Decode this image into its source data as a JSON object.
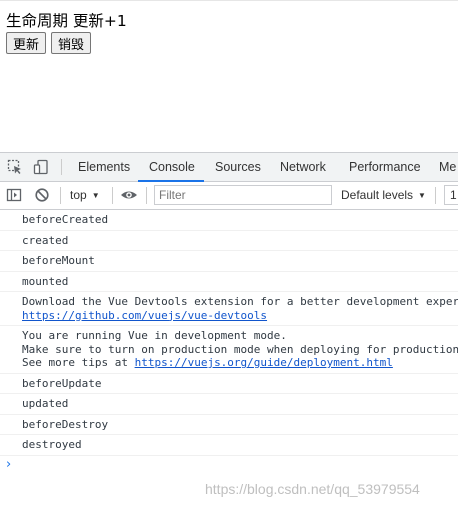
{
  "page": {
    "title": "生命周期 更新+1",
    "update_button": "更新",
    "destroy_button": "销毁"
  },
  "devtools": {
    "tabs": [
      {
        "label": "Elements"
      },
      {
        "label": "Console"
      },
      {
        "label": "Sources"
      },
      {
        "label": "Network"
      },
      {
        "label": "Performance"
      },
      {
        "label": "Me"
      }
    ],
    "active_tab": "Console",
    "toolbar": {
      "context": "top",
      "filter_placeholder": "Filter",
      "levels": "Default levels",
      "count": "1"
    },
    "console": {
      "messages": [
        {
          "text": "beforeCreated"
        },
        {
          "text": "created"
        },
        {
          "text": "beforeMount"
        },
        {
          "text": "mounted"
        },
        {
          "line1": "Download the Vue Devtools extension for a better development exper",
          "link": "https://github.com/vuejs/vue-devtools"
        },
        {
          "line1": "You are running Vue in development mode.",
          "line2": "Make sure to turn on production mode when deploying for production",
          "line3_prefix": "See more tips at ",
          "link": "https://vuejs.org/guide/deployment.html"
        },
        {
          "text": "beforeUpdate"
        },
        {
          "text": "updated"
        },
        {
          "text": "beforeDestroy"
        },
        {
          "text": "destroyed"
        }
      ],
      "prompt": "›"
    }
  },
  "watermark": "https://blog.csdn.net/qq_53979554",
  "colors": {
    "accent": "#1a73e8",
    "link": "#1155cc",
    "tabbar_bg": "#f1f3f4"
  }
}
